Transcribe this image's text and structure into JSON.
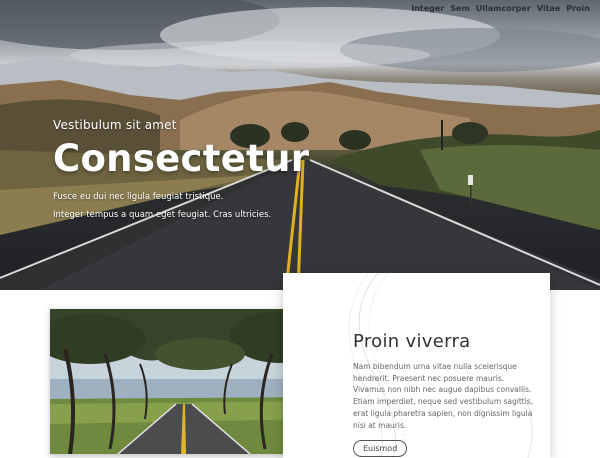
{
  "nav": {
    "items": [
      "Integer",
      "Sem",
      "Ullamcorper",
      "Vitae",
      "Proin"
    ]
  },
  "hero": {
    "kicker": "Vestibulum sit amet",
    "title": "Consectetur",
    "line1": "Fusce eu dui nec ligula feugiat tristique.",
    "line2": "Integer tempus a quam eget feugiat. Cras ultricies."
  },
  "card": {
    "title": "Proin viverra",
    "text": "Nam bibendum urna vitae nulla scelerisque hendrerit. Praesent nec posuere mauris. Vivamus non nibh nec augue dapibus convallis. Etiam imperdiet, neque sed vestibulum sagittis, erat ligula pharetra sapien, non dignissim ligula nisi at mauris.",
    "button_label": "Euismod"
  },
  "colors": {
    "nav_text": "#2a3038",
    "hero_text": "#ffffff",
    "road_line": "#e0b020",
    "card_title": "#333333",
    "card_text": "#666666"
  }
}
